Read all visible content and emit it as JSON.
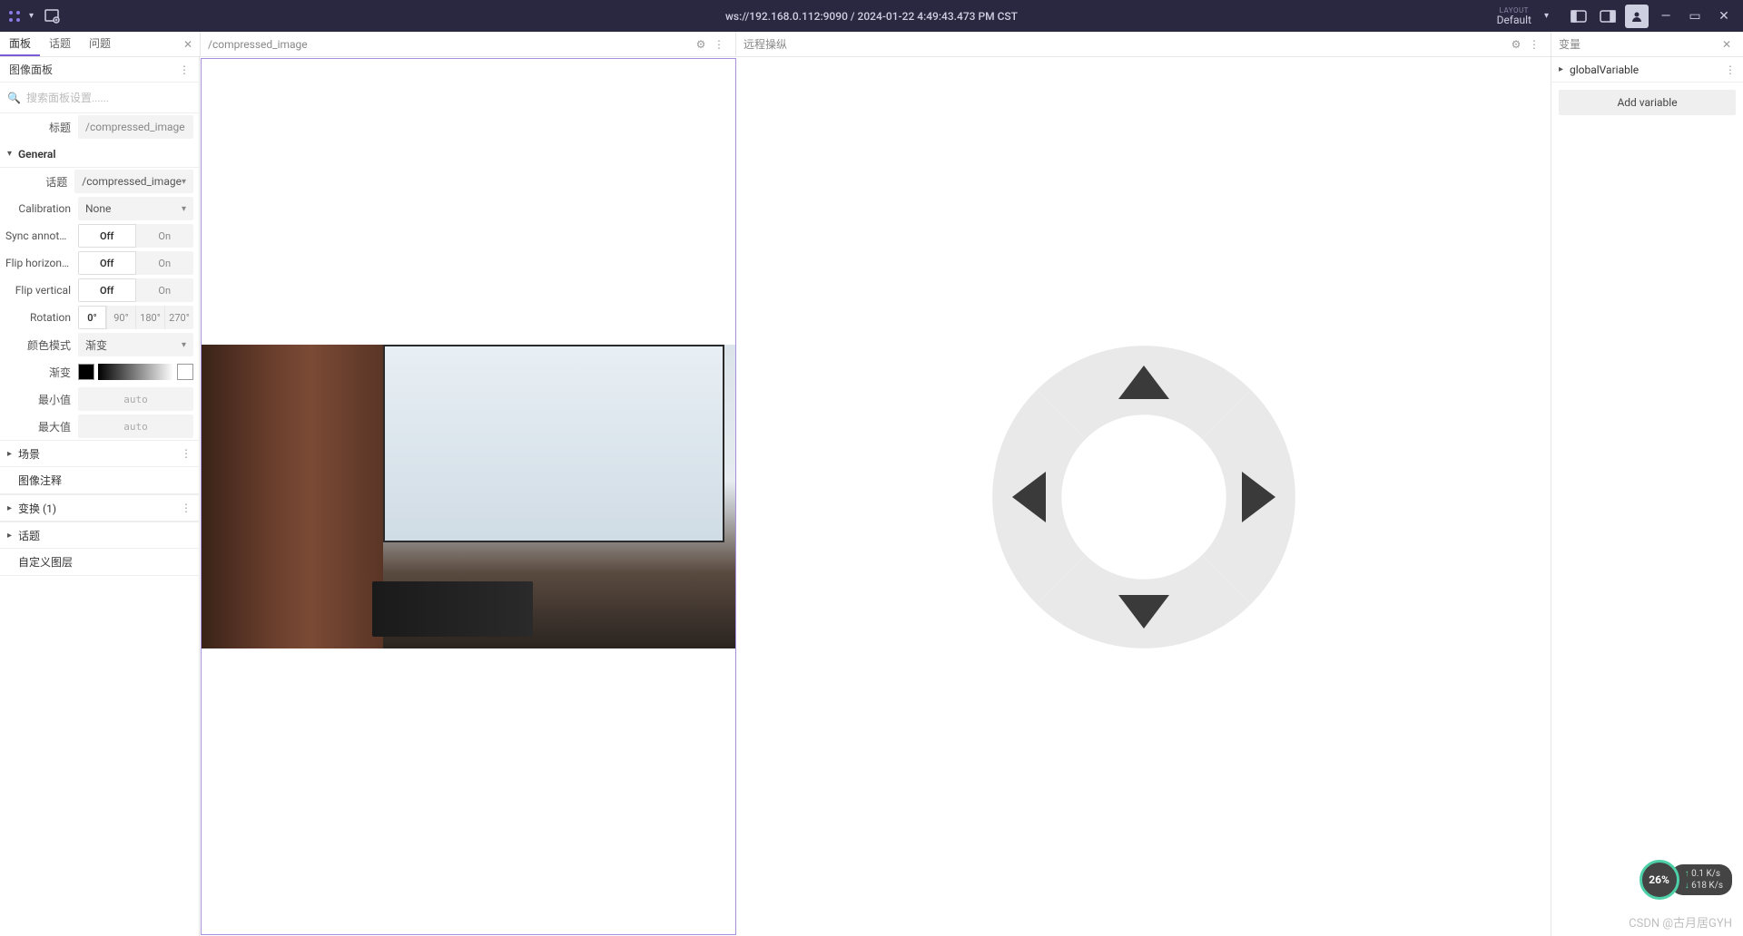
{
  "topbar": {
    "title": "ws://192.168.0.112:9090 / 2024-01-22 4:49:43.473 PM CST",
    "layout_label": "LAYOUT",
    "layout_value": "Default"
  },
  "tabs": {
    "items": [
      "面板",
      "话题",
      "问题"
    ],
    "active_index": 0
  },
  "image_panel": {
    "title": "/compressed_image"
  },
  "teleop_panel": {
    "title": "远程操纵"
  },
  "sidebar": {
    "header": "图像面板",
    "search_placeholder": "搜索面板设置......",
    "title_label": "标题",
    "title_value": "/compressed_image",
    "general_label": "General",
    "topic_label": "话题",
    "topic_value": "/compressed_image",
    "calibration_label": "Calibration",
    "calibration_value": "None",
    "sync_label": "Sync annota...",
    "flip_h_label": "Flip horizontal",
    "flip_v_label": "Flip vertical",
    "off_label": "Off",
    "on_label": "On",
    "rotation_label": "Rotation",
    "rotation_options": [
      "0°",
      "90°",
      "180°",
      "270°"
    ],
    "color_mode_label": "颜色模式",
    "color_mode_value": "渐变",
    "gradient_label": "渐变",
    "min_label": "最小值",
    "max_label": "最大值",
    "auto_value": "auto",
    "sections": {
      "scene": "场景",
      "annotation": "图像注释",
      "transform": "变换 (1)",
      "topics": "话题",
      "custom_layers": "自定义图层"
    }
  },
  "variables": {
    "header": "变量",
    "items": [
      "globalVariable"
    ],
    "add_label": "Add variable"
  },
  "net": {
    "cpu": "26%",
    "up": "0.1 K/s",
    "down": "618 K/s"
  },
  "watermark": "CSDN @古月居GYH"
}
